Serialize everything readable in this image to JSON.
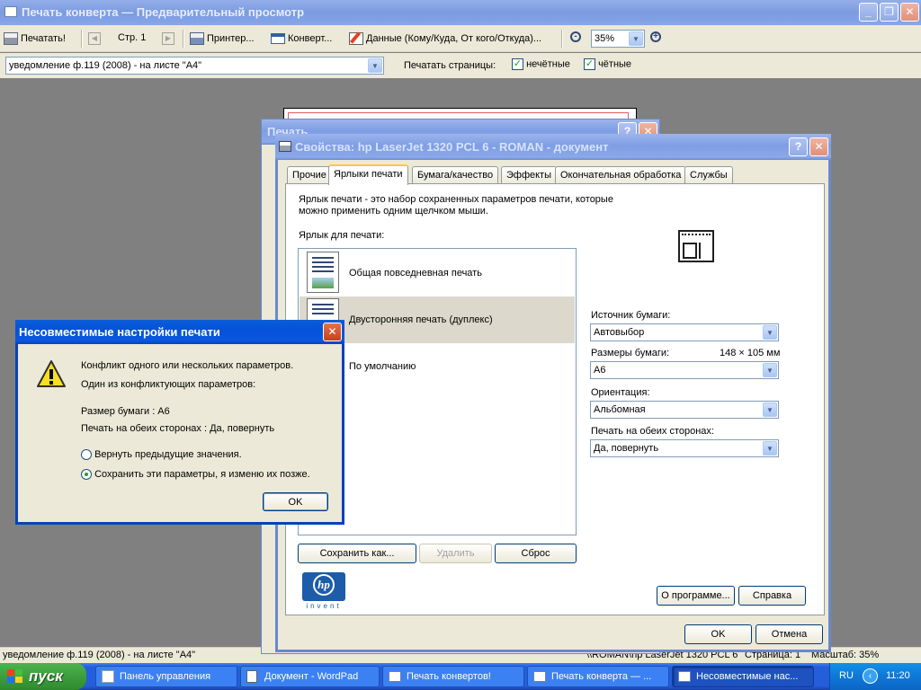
{
  "main_window": {
    "title": "Печать конверта — Предварительный просмотр",
    "toolbar": {
      "print": "Печатать!",
      "page": "Стр. 1",
      "printer": "Принтер...",
      "envelope": "Конверт...",
      "data": "Данные (Кому/Куда, От кого/Откуда)...",
      "zoom": "35%"
    },
    "template_select": "уведомление ф.119 (2008) - на листе \"А4\"",
    "print_pages_label": "Печатать страницы:",
    "odd_label": "нечётные",
    "even_label": "чётные",
    "odd_checked": true,
    "even_checked": true
  },
  "status_bar": {
    "template": "уведомление ф.119 (2008) - на листе \"А4\"",
    "printer": "\\\\ROMAN\\hp LaserJet 1320 PCL 6",
    "page": "Страница: 1",
    "zoom": "Масштаб: 35%"
  },
  "print_dialog_back": {
    "title": "Печать"
  },
  "props_dialog": {
    "title": "Свойства: hp LaserJet 1320 PCL 6 - ROMAN - документ",
    "tabs": [
      "Прочие",
      "Ярлыки печати",
      "Бумага/качество",
      "Эффекты",
      "Окончательная обработка",
      "Службы"
    ],
    "active_tab": "Ярлыки печати",
    "description": "Ярлык печати - это набор сохраненных параметров печати, которые можно применить одним щелчком мыши.",
    "list_label": "Ярлык для печати:",
    "shortcuts": [
      {
        "label": "Общая повседневная печать",
        "selected": false
      },
      {
        "label": "Двусторонняя печать (дуплекс)",
        "selected": true
      },
      {
        "label": "По умолчанию",
        "selected": false
      }
    ],
    "paper_source_label": "Источник бумаги:",
    "paper_source": "Автовыбор",
    "paper_size_label": "Размеры бумаги:",
    "paper_size_dims": "148 × 105 мм",
    "paper_size": "A6",
    "orientation_label": "Ориентация:",
    "orientation": "Альбомная",
    "duplex_label": "Печать на обеих сторонах:",
    "duplex": "Да, повернуть",
    "save_as": "Сохранить как...",
    "delete": "Удалить",
    "reset": "Сброс",
    "about": "О программе...",
    "help": "Справка",
    "ok": "OK",
    "cancel": "Отмена",
    "logo_sub": "invent"
  },
  "conflict_dialog": {
    "title": "Несовместимые настройки печати",
    "line1": "Конфликт одного или нескольких параметров.",
    "line2": "Один из конфликтующих параметров:",
    "param1": "Размер бумаги : A6",
    "param2": "Печать на обеих сторонах : Да, повернуть",
    "option1": "Вернуть предыдущие значения.",
    "option2": "Сохранить эти параметры, я изменю их позже.",
    "selected_option": 2,
    "ok": "OK"
  },
  "taskbar": {
    "start": "пуск",
    "items": [
      {
        "label": "Панель управления",
        "active": false
      },
      {
        "label": "Документ - WordPad",
        "active": false
      },
      {
        "label": "Печать конвертов!",
        "active": false
      },
      {
        "label": "Печать конверта — ...",
        "active": false
      },
      {
        "label": "Несовместимые нас...",
        "active": true
      }
    ],
    "lang": "RU",
    "clock": "11:20"
  }
}
